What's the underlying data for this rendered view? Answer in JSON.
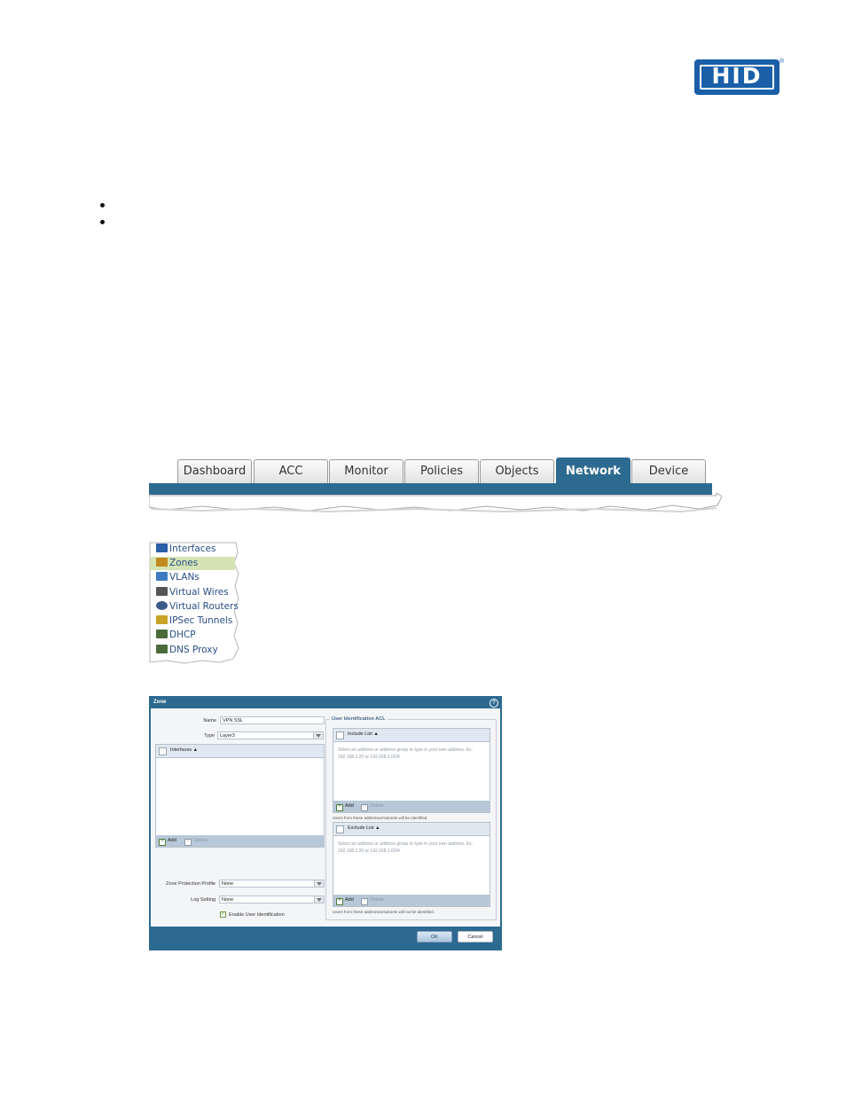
{
  "logo": {
    "text": "HID",
    "mark": "®"
  },
  "tabs": [
    "Dashboard",
    "ACC",
    "Monitor",
    "Policies",
    "Objects",
    "Network",
    "Device"
  ],
  "active_tab": "Network",
  "nav": {
    "items": [
      {
        "label": "Interfaces",
        "icon": "interfaces-icon",
        "color": "#2b5fa6"
      },
      {
        "label": "Zones",
        "icon": "zones-icon",
        "color": "#c08a1e"
      },
      {
        "label": "VLANs",
        "icon": "vlans-icon",
        "color": "#3d7ac0"
      },
      {
        "label": "Virtual Wires",
        "icon": "virtual-wires-icon",
        "color": "#555555"
      },
      {
        "label": "Virtual Routers",
        "icon": "virtual-routers-icon",
        "color": "#3a5a8a"
      },
      {
        "label": "IPSec Tunnels",
        "icon": "ipsec-tunnels-icon",
        "color": "#c9a227"
      },
      {
        "label": "DHCP",
        "icon": "dhcp-icon",
        "color": "#4a6a3a"
      },
      {
        "label": "DNS Proxy",
        "icon": "dns-proxy-icon",
        "color": "#4a6a3a"
      }
    ],
    "selected": "Zones"
  },
  "dialog": {
    "title": "Zone",
    "name_label": "Name",
    "name_value": "VPN SSL",
    "type_label": "Type",
    "type_value": "Layer3",
    "interfaces_header": "Interfaces ▲",
    "add_label": "Add",
    "delete_label": "Delete",
    "zpp_label": "Zone Protection Profile",
    "zpp_value": "None",
    "log_label": "Log Setting",
    "log_value": "None",
    "enable_uid_label": "Enable User Identification",
    "uid_group_title": "User Identification ACL",
    "include_header": "Include List ▲",
    "exclude_header": "Exclude List ▲",
    "hint_text": "Select an address or address group or type in your own address. Ex: 192.168.1.20 or 192.168.1.0/24",
    "include_note": "Users from these addresses/subnets will be identified.",
    "exclude_note": "Users from these addresses/subnets will not be identified.",
    "ok_label": "OK",
    "cancel_label": "Cancel"
  },
  "colors": {
    "accent": "#2d6a90",
    "brand": "#1a5fa8",
    "selection": "#d5e3b5"
  }
}
